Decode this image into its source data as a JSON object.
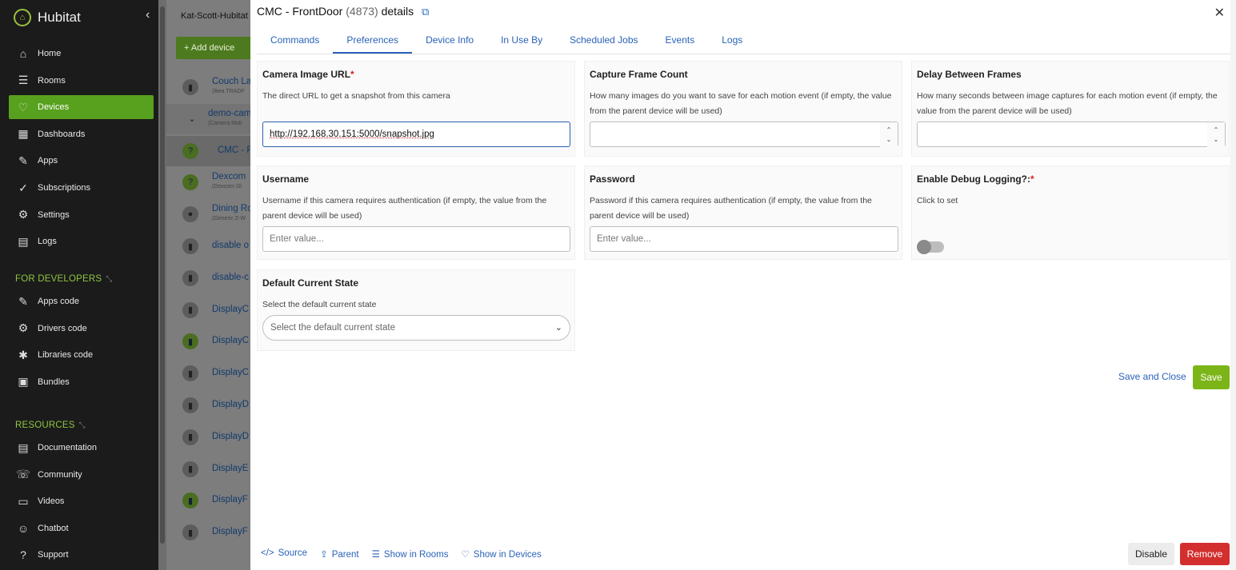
{
  "sidebar": {
    "brand": "Hubitat",
    "items": [
      {
        "label": "Home",
        "icon": "home-icon",
        "glyph": "⌂"
      },
      {
        "label": "Rooms",
        "icon": "rooms-icon",
        "glyph": "☰"
      },
      {
        "label": "Devices",
        "icon": "devices-icon",
        "glyph": "♡"
      },
      {
        "label": "Dashboards",
        "icon": "dashboards-icon",
        "glyph": "▦"
      },
      {
        "label": "Apps",
        "icon": "apps-icon",
        "glyph": "✎"
      },
      {
        "label": "Subscriptions",
        "icon": "subscriptions-icon",
        "glyph": "✓"
      },
      {
        "label": "Settings",
        "icon": "settings-icon",
        "glyph": "⚙"
      },
      {
        "label": "Logs",
        "icon": "logs-icon",
        "glyph": "▤"
      }
    ],
    "developers_label": "FOR DEVELOPERS",
    "developer_items": [
      {
        "label": "Apps code",
        "icon": "apps-code-icon",
        "glyph": "✎"
      },
      {
        "label": "Drivers code",
        "icon": "drivers-code-icon",
        "glyph": "⚙"
      },
      {
        "label": "Libraries code",
        "icon": "libraries-code-icon",
        "glyph": "✱"
      },
      {
        "label": "Bundles",
        "icon": "bundles-icon",
        "glyph": "▣"
      }
    ],
    "resources_label": "RESOURCES",
    "resource_items": [
      {
        "label": "Documentation",
        "icon": "documentation-icon",
        "glyph": "▤"
      },
      {
        "label": "Community",
        "icon": "community-icon",
        "glyph": "☏"
      },
      {
        "label": "Videos",
        "icon": "videos-icon",
        "glyph": "▭"
      },
      {
        "label": "Chatbot",
        "icon": "chatbot-icon",
        "glyph": "☺"
      },
      {
        "label": "Support",
        "icon": "support-icon",
        "glyph": "?"
      }
    ],
    "active_color": "#58a11e"
  },
  "middle": {
    "hub_name": "Kat-Scott-Hubitat",
    "add_device": "+ Add device",
    "devices": [
      {
        "name": "Couch La",
        "sub": "(Ikea TRADF",
        "glyph": "▮"
      },
      {
        "name": "demo-cam",
        "sub": "(Camera Moti",
        "glyph": "⌄"
      },
      {
        "name": "CMC - F",
        "sub": "",
        "glyph": "?"
      },
      {
        "name": "Dexcom",
        "sub": "(Dexcom Gl",
        "glyph": "?"
      },
      {
        "name": "Dining Ro",
        "sub": "(Generic Z-W",
        "glyph": "●"
      },
      {
        "name": "disable o",
        "sub": "",
        "glyph": "▮"
      },
      {
        "name": "disable-c",
        "sub": "",
        "glyph": "▮"
      },
      {
        "name": "DisplayC",
        "sub": "",
        "glyph": "▮"
      },
      {
        "name": "DisplayC",
        "sub": "",
        "glyph": "▮"
      },
      {
        "name": "DisplayC",
        "sub": "",
        "glyph": "▮"
      },
      {
        "name": "DisplayD",
        "sub": "",
        "glyph": "▮"
      },
      {
        "name": "DisplayD",
        "sub": "",
        "glyph": "▮"
      },
      {
        "name": "DisplayE",
        "sub": "",
        "glyph": "▮"
      },
      {
        "name": "DisplayF",
        "sub": "",
        "glyph": "▮"
      },
      {
        "name": "DisplayF",
        "sub": "",
        "glyph": "▮"
      }
    ]
  },
  "modal": {
    "title": "CMC - FrontDoor",
    "device_id": "(4873)",
    "title_suffix": "details",
    "tabs": [
      "Commands",
      "Preferences",
      "Device Info",
      "In Use By",
      "Scheduled Jobs",
      "Events",
      "Logs"
    ],
    "active_tab": "Preferences",
    "prefs": {
      "camera_url": {
        "label": "Camera Image URL",
        "required": "*",
        "desc": "The direct URL to get a snapshot from this camera",
        "value": "http://192.168.30.151:5000/snapshot.jpg"
      },
      "frame_count": {
        "label": "Capture Frame Count",
        "desc": "How many images do you want to save for each motion event (if empty, the value from the parent device will be used)",
        "value": ""
      },
      "delay_frames": {
        "label": "Delay Between Frames",
        "desc": "How many seconds between image captures for each motion event (if empty, the value from the parent device will be used)",
        "value": ""
      },
      "username": {
        "label": "Username",
        "desc": "Username if this camera requires authentication (if empty, the value from the parent device will be used)",
        "placeholder": "Enter value..."
      },
      "password": {
        "label": "Password",
        "desc": "Password if this camera requires authentication (if empty, the value from the parent device will be used)",
        "placeholder": "Enter value..."
      },
      "debug": {
        "label": "Enable Debug Logging?:",
        "required": "*",
        "desc": "Click to set",
        "enabled": false
      },
      "default_state": {
        "label": "Default Current State",
        "desc": "Select the default current state",
        "placeholder": "Select the default current state"
      }
    },
    "save_close": "Save and Close",
    "save": "Save",
    "footer": {
      "source": "Source",
      "parent": "Parent",
      "show_rooms": "Show in Rooms",
      "show_devices": "Show in Devices"
    },
    "disable": "Disable",
    "remove": "Remove",
    "accent_color": "#2a62b8",
    "save_color": "#7cb518",
    "remove_color": "#d32f2f"
  }
}
